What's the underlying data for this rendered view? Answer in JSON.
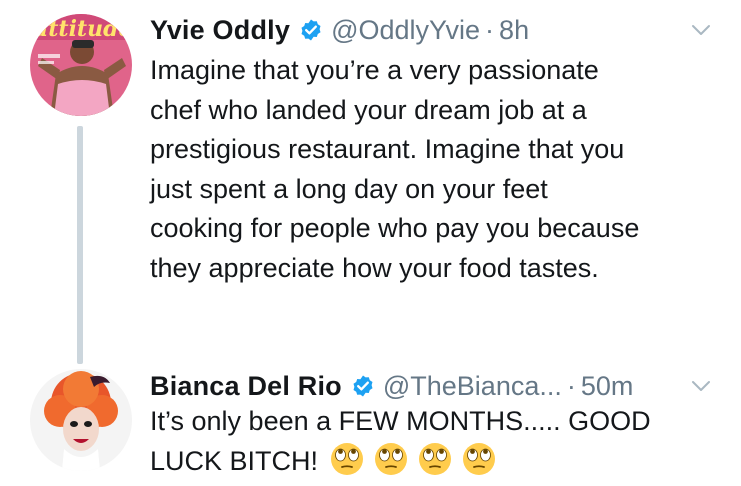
{
  "tweets": [
    {
      "display_name": "Yvie Oddly",
      "handle": "@OddlyYvie",
      "separator": "·",
      "timestamp": "8h",
      "text_lines": [
        "Imagine that you’re a very passionate",
        "chef who landed your dream job at a",
        "prestigious restaurant. Imagine that you",
        "just spent a long day on your feet",
        "cooking for people who pay you because",
        "they appreciate how your food tastes."
      ],
      "avatar_text": "attitude"
    },
    {
      "display_name": "Bianca Del Rio",
      "handle": "@TheBianca...",
      "separator": "·",
      "timestamp": "50m",
      "text_lines": [
        "It’s only been a FEW MONTHS..... GOOD",
        "LUCK BITCH!"
      ],
      "emoji": [
        "face-with-rolling-eyes",
        "face-with-rolling-eyes",
        "face-with-rolling-eyes",
        "face-with-rolling-eyes"
      ]
    }
  ],
  "colors": {
    "verified_blue": "#1da1f2",
    "secondary_text": "#657786",
    "thread_line": "#ccd6dd",
    "emoji_yellow": "#ffcc4d"
  }
}
